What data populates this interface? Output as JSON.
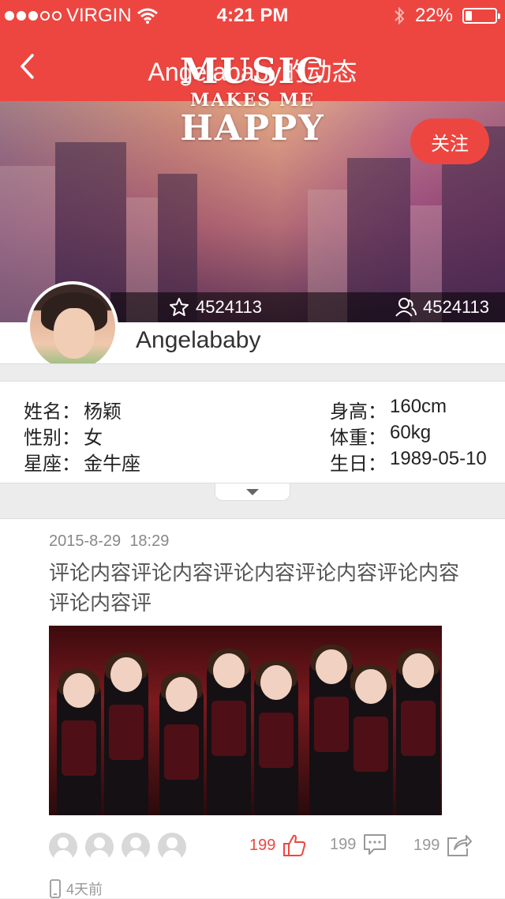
{
  "status_bar": {
    "carrier": "VIRGIN",
    "time": "4:21 PM",
    "battery": "22%",
    "battery_level": 0.22,
    "signal_bars_filled": 3,
    "signal_bars_total": 5
  },
  "nav": {
    "title": "Angelababy的动态",
    "back_icon": "chevron-left-icon"
  },
  "banner": {
    "line1": "MUSIC",
    "line2": "MAKES ME",
    "line3": "HAPPY",
    "follow_label": "关注",
    "stats": {
      "stars": "4524113",
      "fans": "4524113"
    }
  },
  "profile": {
    "name": "Angelababy"
  },
  "info": {
    "name_label": "姓名：",
    "name_value": "杨颖",
    "gender_label": "性别：",
    "gender_value": "女",
    "zodiac_label": "星座：",
    "zodiac_value": "金牛座",
    "height_label": "身高：",
    "height_value": "160cm",
    "weight_label": "体重：",
    "weight_value": "60kg",
    "birthday_label": "生日：",
    "birthday_value": "1989-05-10"
  },
  "post": {
    "date": "2015-8-29",
    "time": "18:29",
    "text": "评论内容评论内容评论内容评论内容评论内容评论内容评",
    "likers_count_shown": 4,
    "likes": "199",
    "comments": "199",
    "shares": "199",
    "relative_time": "4天前"
  },
  "colors": {
    "accent": "#ed4640",
    "muted": "#999999"
  }
}
